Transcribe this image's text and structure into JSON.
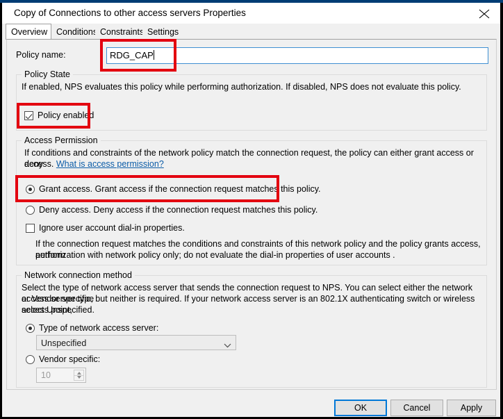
{
  "window": {
    "title": "Copy of Connections to other access servers Properties",
    "close_icon": "close-icon"
  },
  "tabs": [
    {
      "label": "Overview",
      "active": true
    },
    {
      "label": "Conditions",
      "active": false
    },
    {
      "label": "Constraints",
      "active": false
    },
    {
      "label": "Settings",
      "active": false
    }
  ],
  "policy_name": {
    "label": "Policy name:",
    "value": "RDG_CAP"
  },
  "policy_state": {
    "group_title": "Policy State",
    "description": "If enabled, NPS evaluates this policy while performing authorization. If disabled, NPS does not evaluate this policy.",
    "checkbox_label": "Policy enabled",
    "checked": true
  },
  "access_permission": {
    "group_title": "Access Permission",
    "description_line1": "If conditions and constraints of the network policy match the connection request, the policy can either grant access or deny",
    "description_line2_prefix": "access.",
    "link_text": "What is access permission?",
    "grant_label": "Grant access. Grant access if the connection request matches this policy.",
    "grant_selected": true,
    "deny_label": "Deny access. Deny access if the connection request matches this policy.",
    "deny_selected": false,
    "ignore_label": "Ignore user account dial-in properties.",
    "ignore_checked": false,
    "ignore_help_line1": "If the connection request matches the conditions and constraints of this network policy and the policy grants access, perform",
    "ignore_help_line2": "authorization with network policy only; do not evaluate the dial-in properties of user accounts ."
  },
  "network_connection_method": {
    "group_title": "Network connection method",
    "description_line1": "Select the type of network access server that sends the connection request to NPS. You can select either the network access server type",
    "description_line2": "or Vendor specific, but neither is required.  If your network access server is an 802.1X authenticating switch or wireless access point,",
    "description_line3": "select Unspecified.",
    "type_radio_label": "Type of network access server:",
    "type_radio_selected": true,
    "type_combo_value": "Unspecified",
    "vendor_radio_label": "Vendor specific:",
    "vendor_radio_selected": false,
    "vendor_spinner_value": "10"
  },
  "footer": {
    "ok_label": "OK",
    "cancel_label": "Cancel",
    "apply_label": "Apply"
  },
  "colors": {
    "accent": "#0078d7",
    "annotation": "#e3000f",
    "titlebar_band": "#003c74",
    "link": "#0b5ca8"
  }
}
